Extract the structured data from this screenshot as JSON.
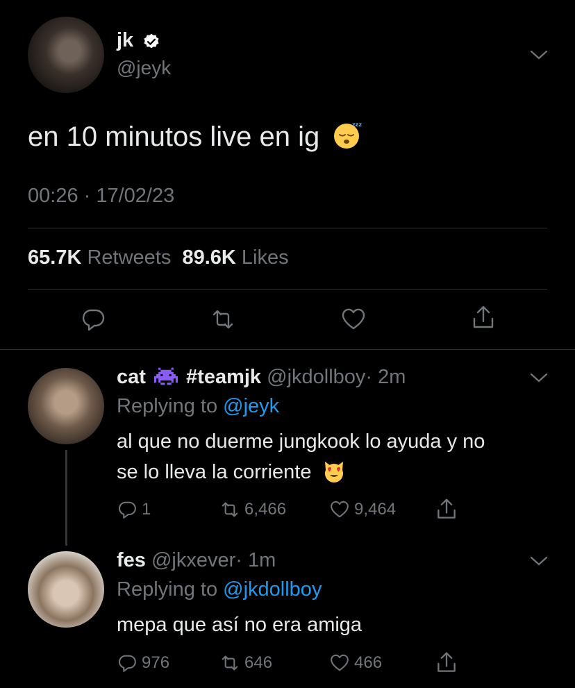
{
  "tweet": {
    "name": "jk",
    "handle": "@jeyk",
    "text": "en 10 minutos live en ig",
    "emoji": "sleeping-face",
    "timestamp": "00:26 · 17/02/23",
    "retweets_count": "65.7K",
    "retweets_label": "Retweets",
    "likes_count": "89.6K",
    "likes_label": "Likes"
  },
  "replies": [
    {
      "name": "cat",
      "name_emoji": "space-invader",
      "name_suffix": "#teamjk",
      "handle": "@jkdollboy",
      "time": "· 2m",
      "replying_label": "Replying to",
      "replying_to": "@jeyk",
      "text_line1": "al que no duerme jungkook lo ayuda y no",
      "text_line2": "se lo lleva la corriente",
      "emoji": "heart-eyes-cat",
      "replies": "1",
      "retweets": "6,466",
      "likes": "9,464"
    },
    {
      "name": "fes",
      "handle": "@jkxever",
      "time": "· 1m",
      "replying_label": "Replying to",
      "replying_to": "@jkdollboy",
      "text_line1": "mepa que así no era amiga",
      "replies": "976",
      "retweets": "646",
      "likes": "466"
    }
  ],
  "colors": {
    "background": "#000000",
    "text": "#e7e9ea",
    "muted": "#71767b",
    "link": "#1d9bf0",
    "divider": "#2f3336"
  }
}
